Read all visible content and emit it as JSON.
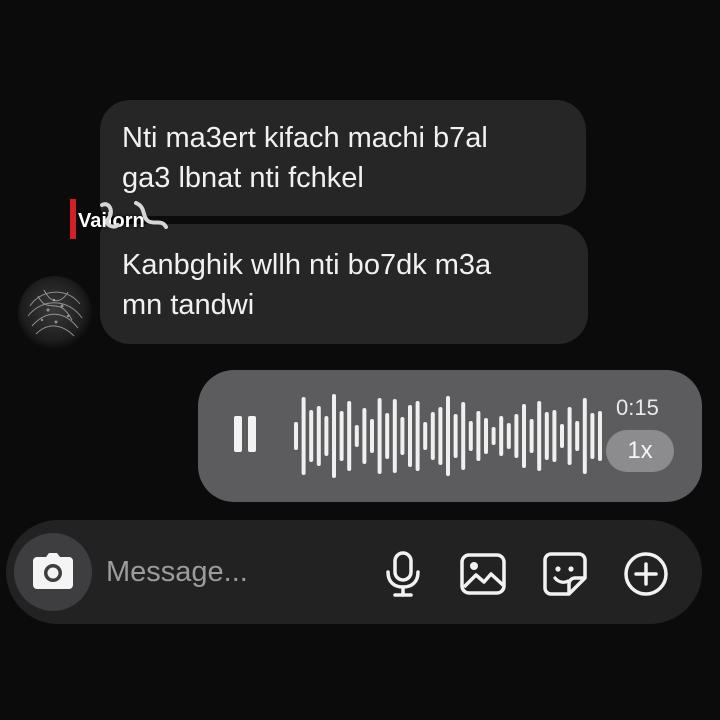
{
  "conversation": {
    "messages": [
      {
        "lines": [
          "Nti ma3ert kifach machi b7al",
          "ga3 lbnat nti fchkel"
        ]
      },
      {
        "lines": [
          "Kanbghik wllh nti bo7dk m3a",
          "mn tandwi"
        ]
      }
    ],
    "sender_tag": {
      "name": "Vailorn",
      "bar_color": "#d32027"
    }
  },
  "voice_message": {
    "duration": "0:15",
    "speed": "1x",
    "state_icon": "pause-icon"
  },
  "composer": {
    "camera_icon": "camera-icon",
    "placeholder": "Message...",
    "icons": [
      "mic-icon",
      "image-icon",
      "sticker-icon",
      "plus-circle-icon"
    ]
  },
  "colors": {
    "background": "#0b0b0c",
    "incoming_bubble": "#262627",
    "voice_bubble": "#5c5c5e",
    "composer": "#222223",
    "sender_bar": "#d32027"
  }
}
